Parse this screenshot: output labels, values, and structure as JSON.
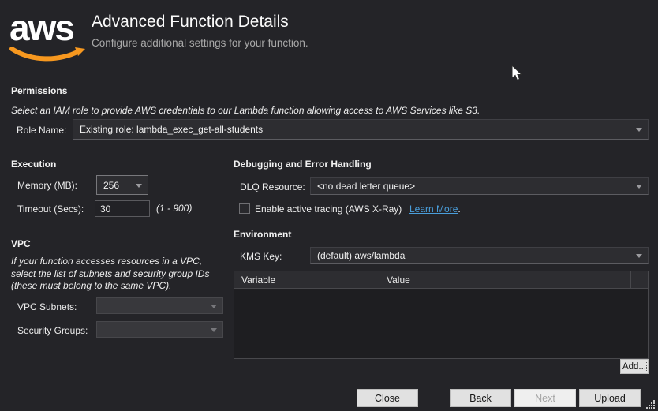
{
  "header": {
    "logo": "aws",
    "title": "Advanced Function Details",
    "subtitle": "Configure additional settings for your function."
  },
  "permissions": {
    "section_label": "Permissions",
    "instruction": "Select an IAM role to provide AWS credentials to our Lambda function allowing access to AWS Services like S3.",
    "role_name_label": "Role Name:",
    "role_name_value": "Existing role: lambda_exec_get-all-students"
  },
  "execution": {
    "section_label": "Execution",
    "memory_label": "Memory (MB):",
    "memory_value": "256",
    "timeout_label": "Timeout (Secs):",
    "timeout_value": "30",
    "timeout_range": "(1 - 900)"
  },
  "vpc": {
    "section_label": "VPC",
    "instruction": "If your function accesses resources in a VPC, select the list of subnets and security group IDs (these must belong to the same VPC).",
    "subnets_label": "VPC Subnets:",
    "subnets_value": "",
    "security_groups_label": "Security Groups:",
    "security_groups_value": ""
  },
  "debugging": {
    "section_label": "Debugging and Error Handling",
    "dlq_label": "DLQ Resource:",
    "dlq_value": "<no dead letter queue>",
    "tracing_checkbox_label": "Enable active tracing (AWS X-Ray)",
    "tracing_checked": false,
    "learn_more_label": "Learn More",
    "learn_more_suffix": "."
  },
  "environment": {
    "section_label": "Environment",
    "kms_label": "KMS Key:",
    "kms_value": "(default) aws/lambda",
    "table": {
      "columns": [
        "Variable",
        "Value"
      ],
      "rows": []
    },
    "add_button_label": "Add..."
  },
  "footer": {
    "close_label": "Close",
    "back_label": "Back",
    "next_label": "Next",
    "next_enabled": false,
    "upload_label": "Upload"
  },
  "colors": {
    "background": "#242428",
    "accent_orange": "#f7981f",
    "link_blue": "#4a9edb",
    "text_primary": "#f1f1f1",
    "text_secondary": "#a9a9a9"
  }
}
